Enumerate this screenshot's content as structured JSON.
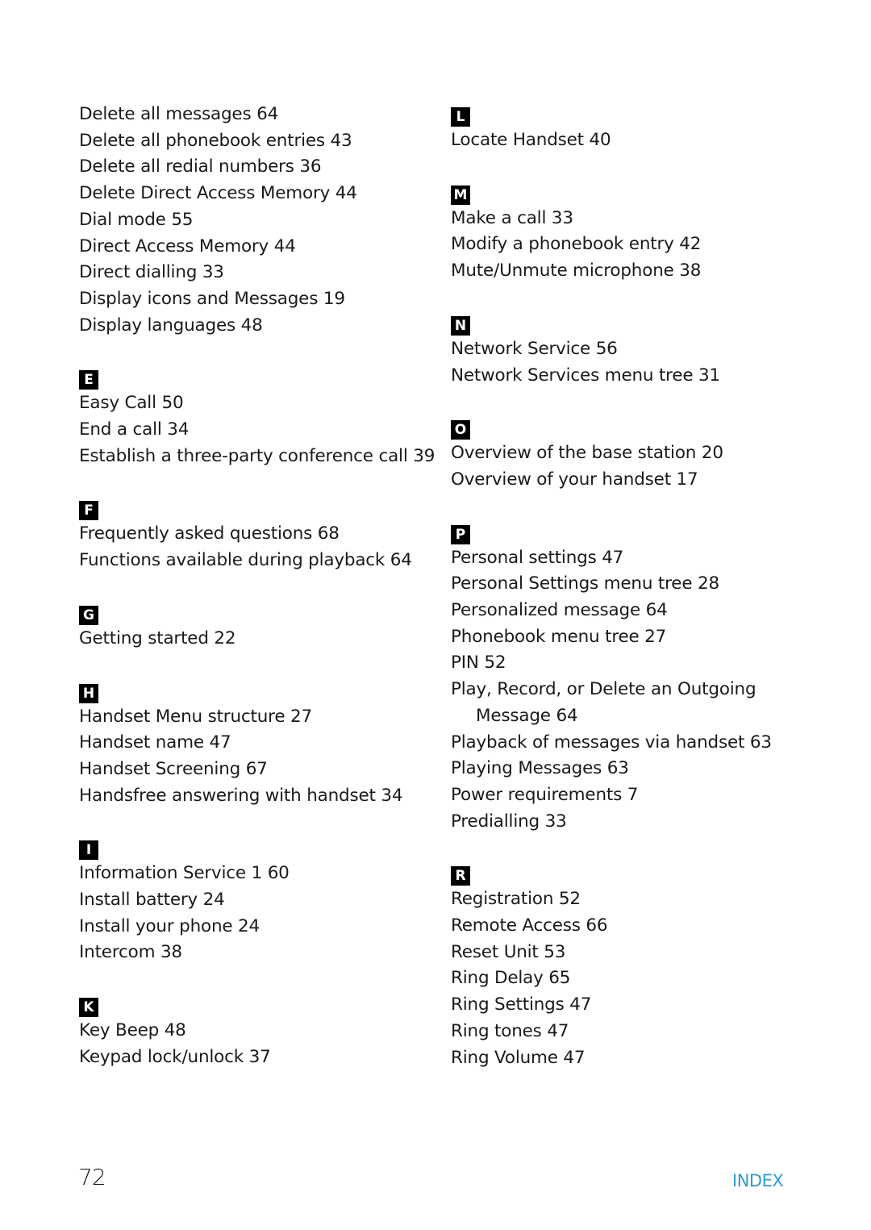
{
  "left_column": {
    "lead_entries": [
      "Delete all messages 64",
      "Delete all phonebook entries 43",
      "Delete all redial numbers 36",
      "Delete Direct Access Memory 44",
      "Dial mode 55",
      "Direct Access Memory 44",
      "Direct dialling 33",
      "Display icons and Messages 19",
      "Display languages 48"
    ],
    "sections": [
      {
        "letter": "E",
        "entries": [
          "Easy Call 50",
          "End a call 34",
          "Establish a three-party conference call 39"
        ]
      },
      {
        "letter": "F",
        "entries": [
          "Frequently asked questions 68",
          "Functions available during playback 64"
        ]
      },
      {
        "letter": "G",
        "entries": [
          "Getting started 22"
        ]
      },
      {
        "letter": "H",
        "entries": [
          "Handset Menu structure 27",
          "Handset name 47",
          "Handset Screening 67",
          "Handsfree answering with handset 34"
        ]
      },
      {
        "letter": "I",
        "entries": [
          "Information Service 1 60",
          "Install battery 24",
          "Install your phone 24",
          "Intercom 38"
        ]
      },
      {
        "letter": "K",
        "entries": [
          "Key Beep 48",
          "Keypad lock/unlock 37"
        ]
      }
    ]
  },
  "right_column": {
    "sections": [
      {
        "letter": "L",
        "entries": [
          "Locate Handset 40"
        ]
      },
      {
        "letter": "M",
        "entries": [
          "Make a call 33",
          "Modify a phonebook entry 42",
          "Mute/Unmute microphone 38"
        ]
      },
      {
        "letter": "N",
        "entries": [
          "Network Service 56",
          "Network Services menu tree 31"
        ]
      },
      {
        "letter": "O",
        "entries": [
          "Overview of the base station 20",
          "Overview of your handset 17"
        ]
      },
      {
        "letter": "P",
        "entries": [
          "Personal settings 47",
          "Personal Settings menu tree 28",
          "Personalized message 64",
          "Phonebook menu tree 27",
          "PIN 52",
          {
            "line1": "Play, Record, or Delete an Outgoing",
            "line2": "Message 64"
          },
          "Playback of messages via handset 63",
          "Playing Messages 63",
          "Power requirements 7",
          "Predialling 33"
        ]
      },
      {
        "letter": "R",
        "entries": [
          "Registration 52",
          "Remote Access 66",
          "Reset Unit 53",
          "Ring Delay 65",
          "Ring Settings 47",
          "Ring tones 47",
          "Ring Volume 47"
        ]
      }
    ]
  },
  "footer": {
    "page_number": "72",
    "section_title": "INDEX",
    "section_title_color": "#2f9bd6"
  }
}
